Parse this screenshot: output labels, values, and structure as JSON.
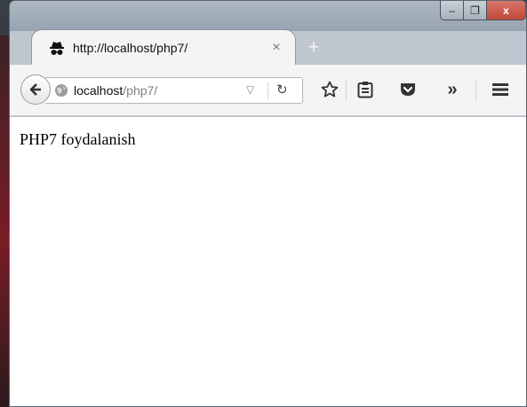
{
  "tab": {
    "title": "http://localhost/php7/",
    "close_label": "×",
    "new_tab_label": "+"
  },
  "window_controls": {
    "minimize_label": "–",
    "maximize_label": "❐",
    "close_label": "x"
  },
  "urlbar": {
    "host": "localhost",
    "path": "/php7/",
    "dropdown_icon": "▽",
    "reload_icon": "↻"
  },
  "toolbar": {
    "icons": [
      "star-icon",
      "reading-list-icon",
      "pocket-icon",
      "overflow-icon",
      "menu-icon"
    ],
    "overflow_label": "»"
  },
  "page": {
    "text": "PHP7 foydalanish"
  },
  "colors": {
    "tab_bg": "#f4f4f4",
    "titlebar": "#a7b2c0",
    "close_red": "#c1483a"
  }
}
